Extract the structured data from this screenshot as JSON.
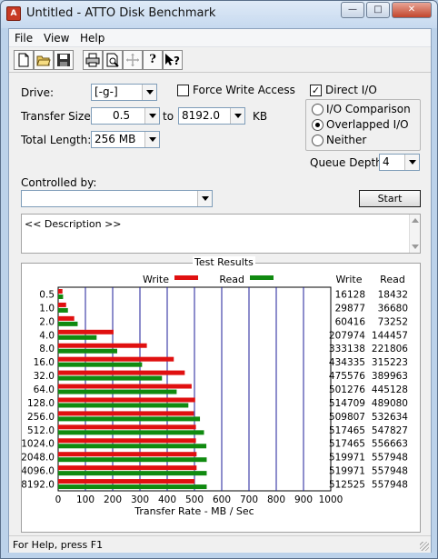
{
  "window": {
    "title": "Untitled - ATTO Disk Benchmark"
  },
  "menu": [
    "File",
    "View",
    "Help"
  ],
  "toolbar_icons": [
    "new-icon",
    "open-icon",
    "save-icon",
    "print-icon",
    "print-preview-icon",
    "move-icon",
    "help-icon",
    "context-help-icon"
  ],
  "form": {
    "drive_label": "Drive:",
    "drive_value": "[-g-]",
    "force_write_label": "Force Write Access",
    "force_write_checked": false,
    "direct_io_label": "Direct I/O",
    "direct_io_checked": true,
    "transfer_size_label": "Transfer Size:",
    "transfer_min": "0.5",
    "to_label": "to",
    "transfer_max": "8192.0",
    "kb_label": "KB",
    "total_length_label": "Total Length:",
    "total_length_value": "256 MB",
    "io_comparison_label": "I/O Comparison",
    "overlapped_io_label": "Overlapped I/O",
    "neither_label": "Neither",
    "selected_mode": "Overlapped I/O",
    "queue_depth_label": "Queue Depth:",
    "queue_depth_value": "4",
    "controlled_by_label": "Controlled by:",
    "controlled_by_value": "",
    "start_label": "Start",
    "description": "<< Description >>"
  },
  "results": {
    "title": "Test Results",
    "legend_write": "Write",
    "legend_read": "Read",
    "col_write": "Write",
    "col_read": "Read",
    "write_color": "#e01010",
    "read_color": "#108a10"
  },
  "chart_data": {
    "type": "bar",
    "orientation": "horizontal",
    "categories": [
      "0.5",
      "1.0",
      "2.0",
      "4.0",
      "8.0",
      "16.0",
      "32.0",
      "64.0",
      "128.0",
      "256.0",
      "512.0",
      "1024.0",
      "2048.0",
      "4096.0",
      "8192.0"
    ],
    "series": [
      {
        "name": "Write",
        "values": [
          16128,
          29877,
          60416,
          207974,
          333138,
          434335,
          475576,
          501276,
          514709,
          509807,
          517465,
          517465,
          519971,
          519971,
          512525
        ]
      },
      {
        "name": "Read",
        "values": [
          18432,
          36680,
          73252,
          144457,
          221806,
          315223,
          389963,
          445128,
          489080,
          532634,
          547827,
          556663,
          557948,
          557948,
          557948
        ]
      }
    ],
    "xlabel": "Transfer Rate - MB / Sec",
    "xticks": [
      "0",
      "100",
      "200",
      "300",
      "400",
      "500",
      "600",
      "700",
      "800",
      "900",
      "1000"
    ],
    "xlim": [
      0,
      1000
    ],
    "units_scale": "values in KB/sec; axis in MB/sec"
  },
  "status": {
    "text": "For Help, press F1"
  }
}
